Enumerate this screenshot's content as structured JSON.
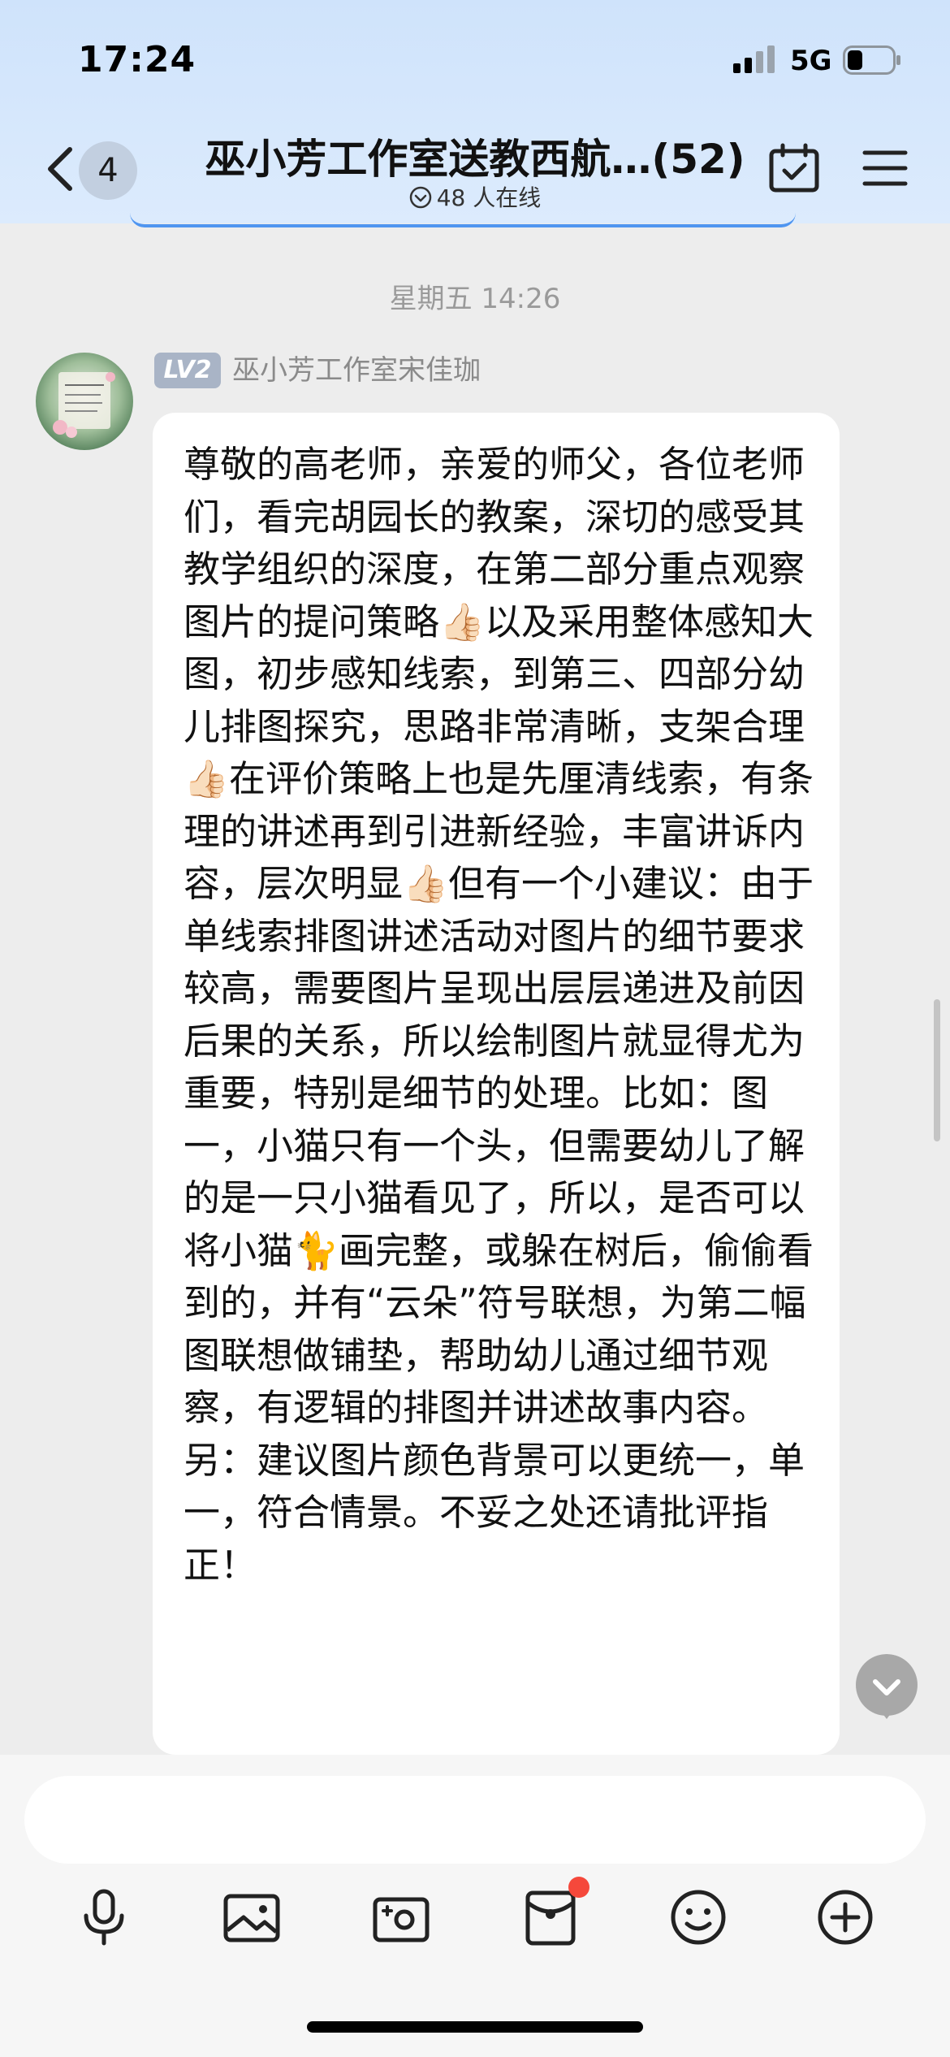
{
  "status_bar": {
    "time": "17:24",
    "network": "5G"
  },
  "header": {
    "unread_count": "4",
    "title": "巫小芳工作室送教西航…(52)",
    "online_status": "48 人在线",
    "icons": [
      "back-arrow-icon",
      "calendar-check-icon",
      "menu-icon"
    ]
  },
  "chat": {
    "timestamp": "星期五 14:26",
    "message": {
      "level_badge": "LV2",
      "sender": "巫小芳工作室宋佳珈",
      "text": "尊敬的高老师，亲爱的师父，各位老师们，看完胡园长的教案，深切的感受其教学组织的深度，在第二部分重点观察图片的提问策略👍🏻以及采用整体感知大图，初步感知线索，到第三、四部分幼儿排图探究，思路非常清晰，支架合理👍🏻在评价策略上也是先厘清线索，有条理的讲述再到引进新经验，丰富讲诉内容，层次明显👍🏻但有一个小建议：由于单线索排图讲述活动对图片的细节要求较高，需要图片呈现出层层递进及前因后果的关系，所以绘制图片就显得尤为重要，特别是细节的处理。比如：图一，小猫只有一个头，但需要幼儿了解的是一只小猫看见了，所以，是否可以将小猫🐈画完整，或躲在树后，偷偷看到的，并有“云朵”符号联想，为第二幅图联想做铺垫，帮助幼儿通过细节观察，有逻辑的排图并讲述故事内容。另：建议图片颜色背景可以更统一，单一，符合情景。不妥之处还请批评指正！"
    }
  },
  "input_bar": {
    "input_value": "",
    "tools": [
      {
        "name": "voice-button",
        "icon": "microphone-icon"
      },
      {
        "name": "image-button",
        "icon": "image-icon"
      },
      {
        "name": "camera-button",
        "icon": "camera-icon"
      },
      {
        "name": "red-packet-button",
        "icon": "red-packet-icon",
        "has_badge": true
      },
      {
        "name": "emoji-button",
        "icon": "emoji-icon"
      },
      {
        "name": "more-button",
        "icon": "plus-circle-icon"
      }
    ]
  },
  "colors": {
    "header_bg": "#d6e8fc",
    "accent": "#4f95f0",
    "chat_bg": "#ededed",
    "bubble_bg": "#ffffff",
    "level_badge_bg": "#a9b4c6",
    "notify_dot": "#f5483b"
  }
}
